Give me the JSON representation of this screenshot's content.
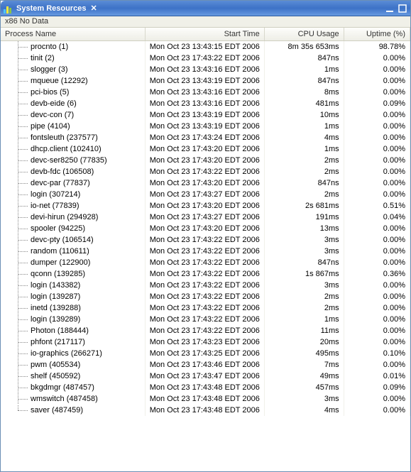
{
  "titlebar": {
    "title": "System Resources",
    "close_glyph": "✕"
  },
  "subheader": {
    "text": "x86 No Data"
  },
  "columns": {
    "name": "Process Name",
    "start": "Start Time",
    "cpu": "CPU Usage",
    "uptime": "Uptime (%)"
  },
  "rows": [
    {
      "name": "procnto (1)",
      "start": "Mon Oct 23 13:43:15 EDT 2006",
      "cpu": "8m 35s 653ms",
      "uptime": "98.78%"
    },
    {
      "name": "tinit (2)",
      "start": "Mon Oct 23 17:43:22 EDT 2006",
      "cpu": "847ns",
      "uptime": "0.00%"
    },
    {
      "name": "slogger (3)",
      "start": "Mon Oct 23 13:43:16 EDT 2006",
      "cpu": "1ms",
      "uptime": "0.00%"
    },
    {
      "name": "mqueue (12292)",
      "start": "Mon Oct 23 13:43:19 EDT 2006",
      "cpu": "847ns",
      "uptime": "0.00%"
    },
    {
      "name": "pci-bios (5)",
      "start": "Mon Oct 23 13:43:16 EDT 2006",
      "cpu": "8ms",
      "uptime": "0.00%"
    },
    {
      "name": "devb-eide (6)",
      "start": "Mon Oct 23 13:43:16 EDT 2006",
      "cpu": "481ms",
      "uptime": "0.09%"
    },
    {
      "name": "devc-con (7)",
      "start": "Mon Oct 23 13:43:19 EDT 2006",
      "cpu": "10ms",
      "uptime": "0.00%"
    },
    {
      "name": "pipe (4104)",
      "start": "Mon Oct 23 13:43:19 EDT 2006",
      "cpu": "1ms",
      "uptime": "0.00%"
    },
    {
      "name": "fontsleuth (237577)",
      "start": "Mon Oct 23 17:43:24 EDT 2006",
      "cpu": "4ms",
      "uptime": "0.00%"
    },
    {
      "name": "dhcp.client (102410)",
      "start": "Mon Oct 23 17:43:20 EDT 2006",
      "cpu": "1ms",
      "uptime": "0.00%"
    },
    {
      "name": "devc-ser8250 (77835)",
      "start": "Mon Oct 23 17:43:20 EDT 2006",
      "cpu": "2ms",
      "uptime": "0.00%"
    },
    {
      "name": "devb-fdc (106508)",
      "start": "Mon Oct 23 17:43:22 EDT 2006",
      "cpu": "2ms",
      "uptime": "0.00%"
    },
    {
      "name": "devc-par (77837)",
      "start": "Mon Oct 23 17:43:20 EDT 2006",
      "cpu": "847ns",
      "uptime": "0.00%"
    },
    {
      "name": "login (307214)",
      "start": "Mon Oct 23 17:43:27 EDT 2006",
      "cpu": "2ms",
      "uptime": "0.00%"
    },
    {
      "name": "io-net (77839)",
      "start": "Mon Oct 23 17:43:20 EDT 2006",
      "cpu": "2s 681ms",
      "uptime": "0.51%"
    },
    {
      "name": "devi-hirun (294928)",
      "start": "Mon Oct 23 17:43:27 EDT 2006",
      "cpu": "191ms",
      "uptime": "0.04%"
    },
    {
      "name": "spooler (94225)",
      "start": "Mon Oct 23 17:43:20 EDT 2006",
      "cpu": "13ms",
      "uptime": "0.00%"
    },
    {
      "name": "devc-pty (106514)",
      "start": "Mon Oct 23 17:43:22 EDT 2006",
      "cpu": "3ms",
      "uptime": "0.00%"
    },
    {
      "name": "random (110611)",
      "start": "Mon Oct 23 17:43:22 EDT 2006",
      "cpu": "3ms",
      "uptime": "0.00%"
    },
    {
      "name": "dumper (122900)",
      "start": "Mon Oct 23 17:43:22 EDT 2006",
      "cpu": "847ns",
      "uptime": "0.00%"
    },
    {
      "name": "qconn (139285)",
      "start": "Mon Oct 23 17:43:22 EDT 2006",
      "cpu": "1s 867ms",
      "uptime": "0.36%"
    },
    {
      "name": "login (143382)",
      "start": "Mon Oct 23 17:43:22 EDT 2006",
      "cpu": "3ms",
      "uptime": "0.00%"
    },
    {
      "name": "login (139287)",
      "start": "Mon Oct 23 17:43:22 EDT 2006",
      "cpu": "2ms",
      "uptime": "0.00%"
    },
    {
      "name": "inetd (139288)",
      "start": "Mon Oct 23 17:43:22 EDT 2006",
      "cpu": "2ms",
      "uptime": "0.00%"
    },
    {
      "name": "login (139289)",
      "start": "Mon Oct 23 17:43:22 EDT 2006",
      "cpu": "1ms",
      "uptime": "0.00%"
    },
    {
      "name": "Photon (188444)",
      "start": "Mon Oct 23 17:43:22 EDT 2006",
      "cpu": "11ms",
      "uptime": "0.00%"
    },
    {
      "name": "phfont (217117)",
      "start": "Mon Oct 23 17:43:23 EDT 2006",
      "cpu": "20ms",
      "uptime": "0.00%"
    },
    {
      "name": "io-graphics (266271)",
      "start": "Mon Oct 23 17:43:25 EDT 2006",
      "cpu": "495ms",
      "uptime": "0.10%"
    },
    {
      "name": "pwm (405534)",
      "start": "Mon Oct 23 17:43:46 EDT 2006",
      "cpu": "7ms",
      "uptime": "0.00%"
    },
    {
      "name": "shelf (450592)",
      "start": "Mon Oct 23 17:43:47 EDT 2006",
      "cpu": "49ms",
      "uptime": "0.01%"
    },
    {
      "name": "bkgdmgr (487457)",
      "start": "Mon Oct 23 17:43:48 EDT 2006",
      "cpu": "457ms",
      "uptime": "0.09%"
    },
    {
      "name": "wmswitch (487458)",
      "start": "Mon Oct 23 17:43:48 EDT 2006",
      "cpu": "3ms",
      "uptime": "0.00%"
    },
    {
      "name": "saver (487459)",
      "start": "Mon Oct 23 17:43:48 EDT 2006",
      "cpu": "4ms",
      "uptime": "0.00%"
    }
  ]
}
